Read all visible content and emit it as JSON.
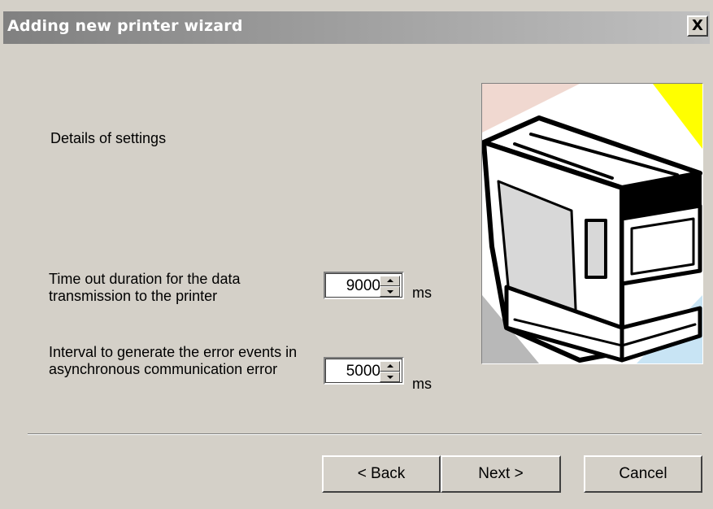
{
  "window": {
    "title": "Adding new printer wizard",
    "close_label": "X"
  },
  "content": {
    "heading": "Details of settings",
    "timeout": {
      "label": "Time out duration for the data transmission to the printer",
      "value": "9000",
      "unit": "ms"
    },
    "interval": {
      "label": "Interval to generate the error events in asynchronous communication error",
      "value": "5000",
      "unit": "ms"
    },
    "illustration_icon": "printer-icon"
  },
  "buttons": {
    "back": "< Back",
    "next": "Next >",
    "cancel": "Cancel"
  },
  "colors": {
    "title_bar_start": "#808080",
    "title_bar_end": "#c0c0c0",
    "dialog_bg": "#d4d0c8",
    "illustration_yellow": "#ffff00",
    "illustration_pink": "#f0d8d0",
    "illustration_blue": "#c8e4f4",
    "illustration_gray": "#b8b8b8"
  }
}
